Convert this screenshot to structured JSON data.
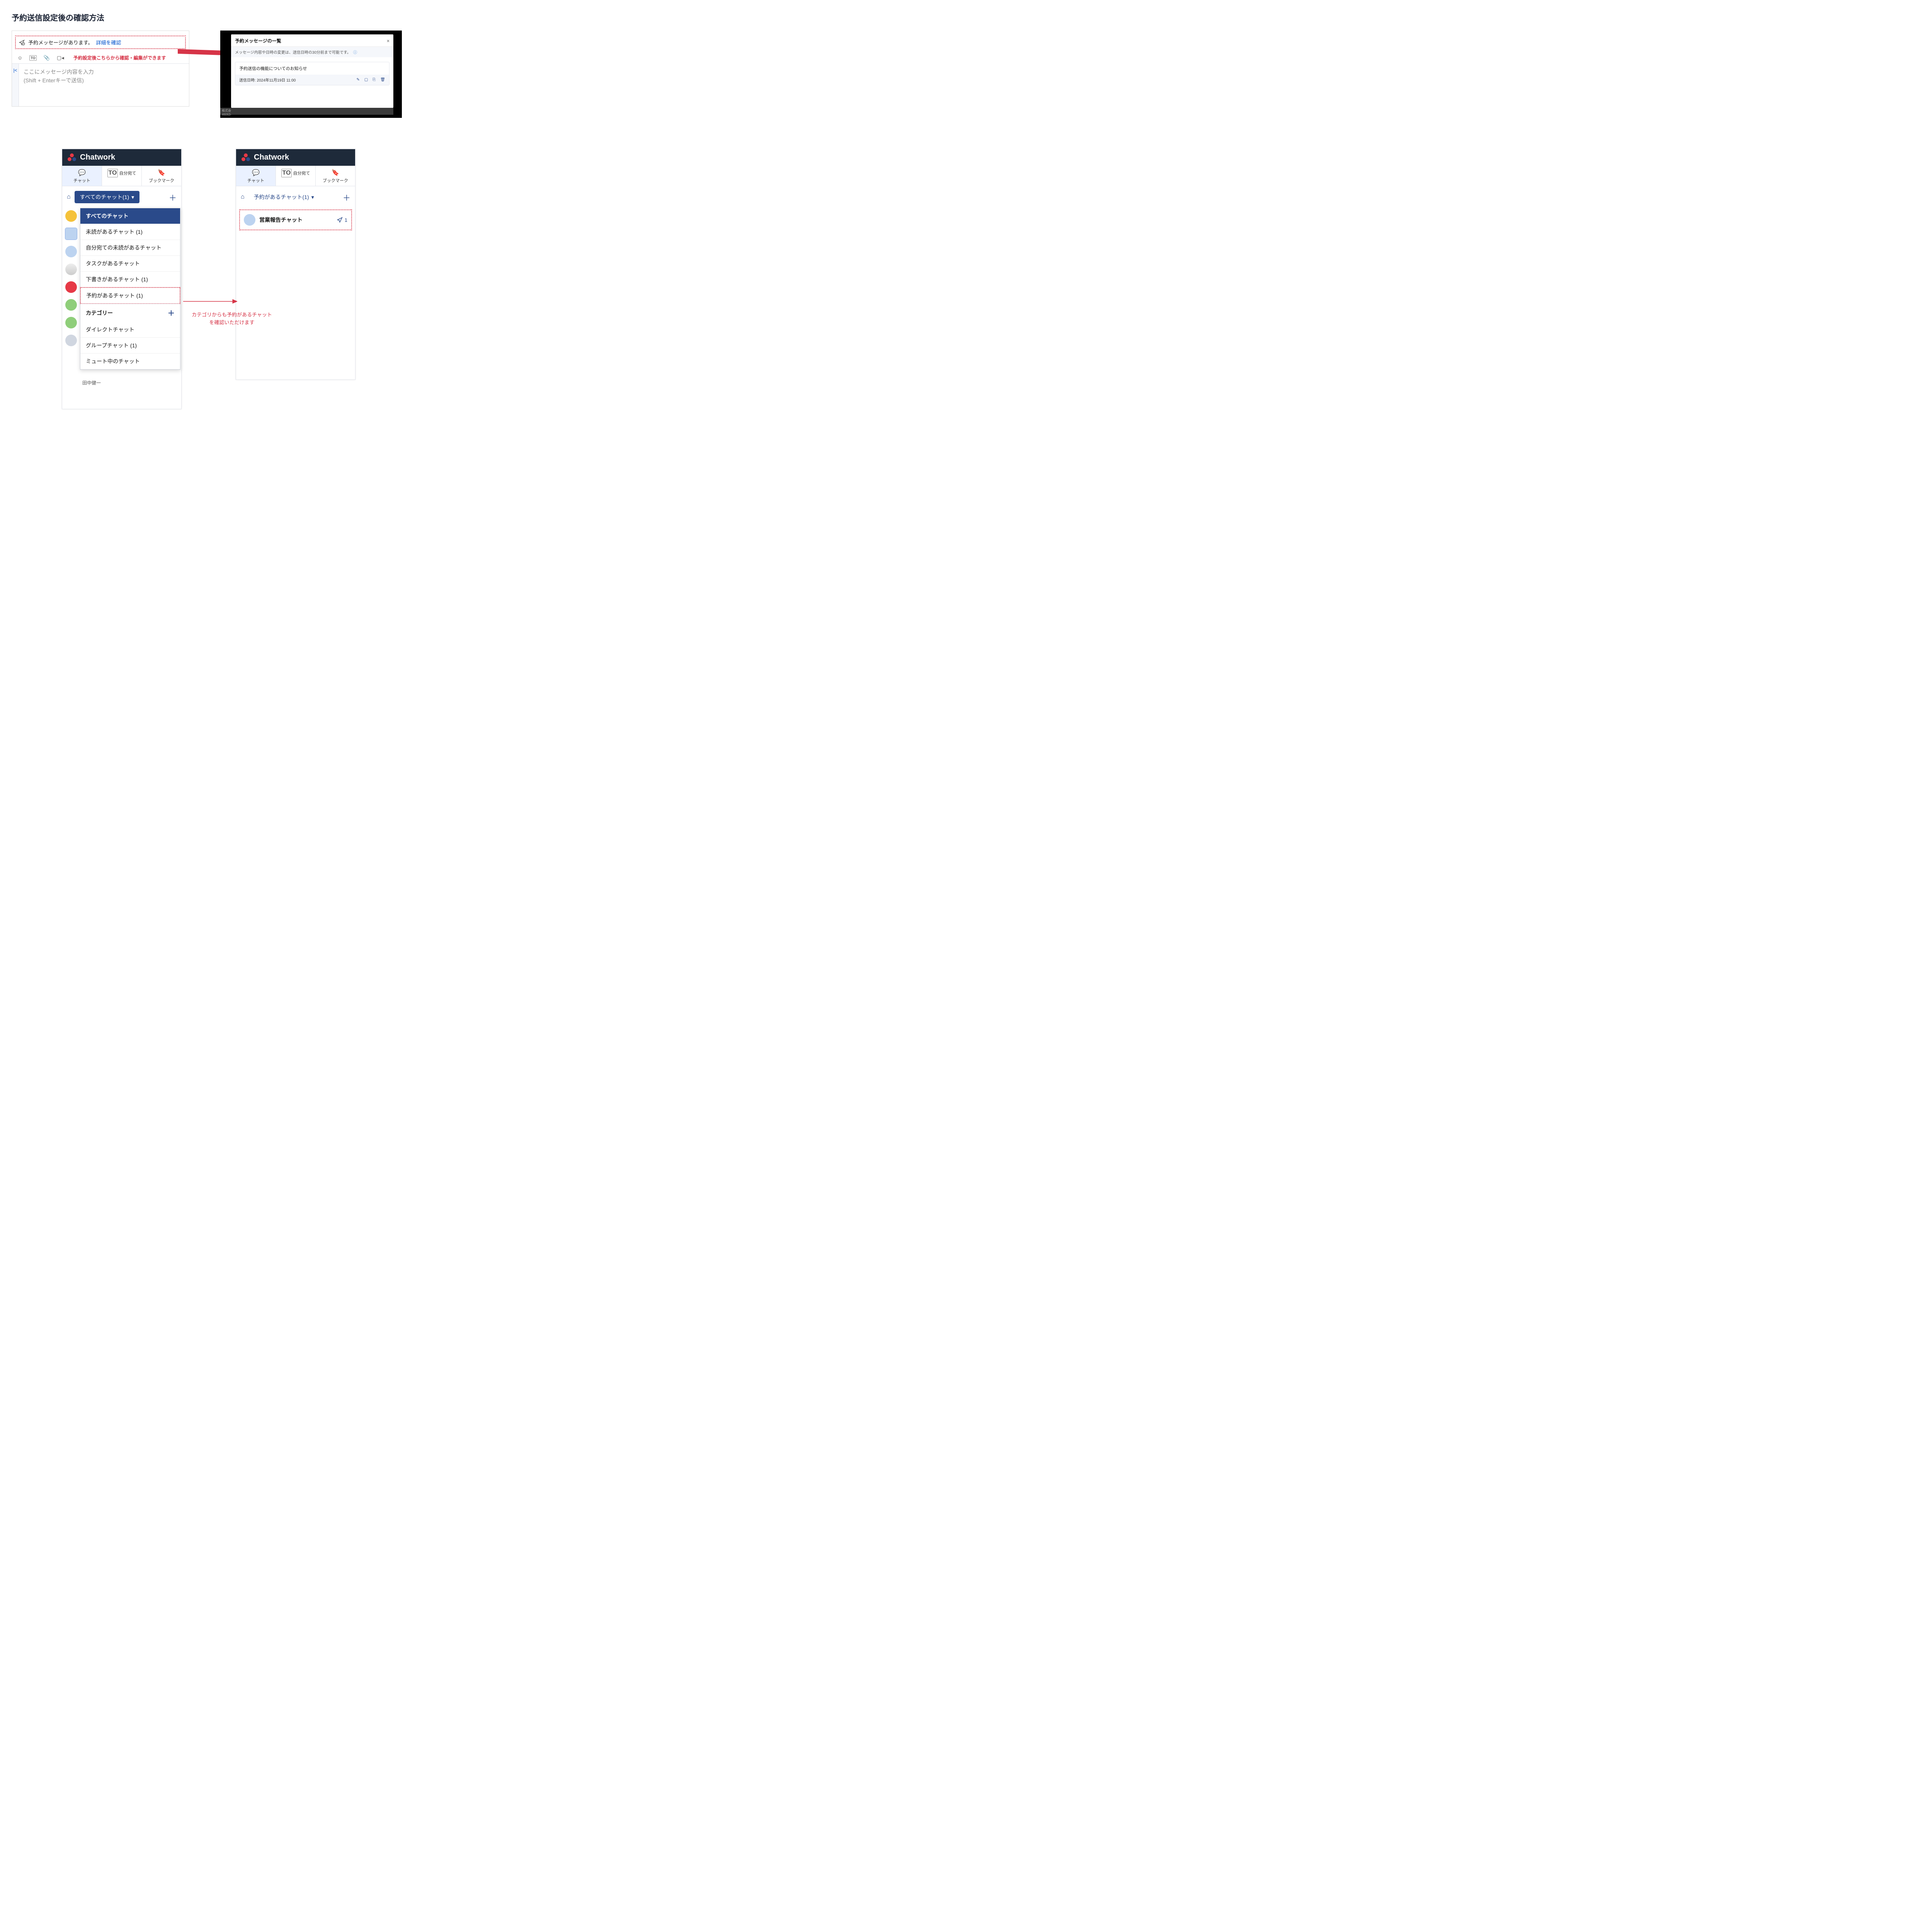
{
  "page_title": "予約送信設定後の確認方法",
  "composer": {
    "banner_text": "予約メッセージがあります。",
    "banner_link": "詳細を確認",
    "annotation": "予約設定後こちらから確認・編集ができます",
    "placeholder_line1": "ここにメッセージ内容を入力",
    "placeholder_line2": "(Shift + Enterキーで送信)",
    "to_label": "TO"
  },
  "modal": {
    "title": "予約メッセージの一覧",
    "subtitle": "メッセージ内容や日時の変更は、送信日時の30分前まで可能です。",
    "item_title": "予約送信の機能についてのお知らせ",
    "item_meta_label": "送信日時:",
    "item_meta_value": "2024年11月19日 11:00",
    "footer1": "株式会",
    "footer2": "46063-"
  },
  "chatwork": {
    "brand": "Chatwork",
    "tabs": {
      "chat": "チャット",
      "self": "自分宛て",
      "bookmark": "ブックマーク"
    },
    "left": {
      "filter_label": "すべてのチャット(1)",
      "dropdown": {
        "all": "すべてのチャット",
        "unread": "未読があるチャット  (1)",
        "self_unread": "自分宛ての未読があるチャット",
        "task": "タスクがあるチャット",
        "draft": "下書きがあるチャット  (1)",
        "scheduled": "予約があるチャット  (1)",
        "category_header": "カテゴリー",
        "direct": "ダイレクトチャット",
        "group": "グループチャット  (1)",
        "mute": "ミュート中のチャット"
      },
      "name_under": "田中健一"
    },
    "right": {
      "filter_label": "予約があるチャット(1)",
      "chat_name": "営業報告チャット",
      "badge_count": "1"
    }
  },
  "annotation_bottom": "カテゴリからも予約があるチャット\nを確認いただけます"
}
